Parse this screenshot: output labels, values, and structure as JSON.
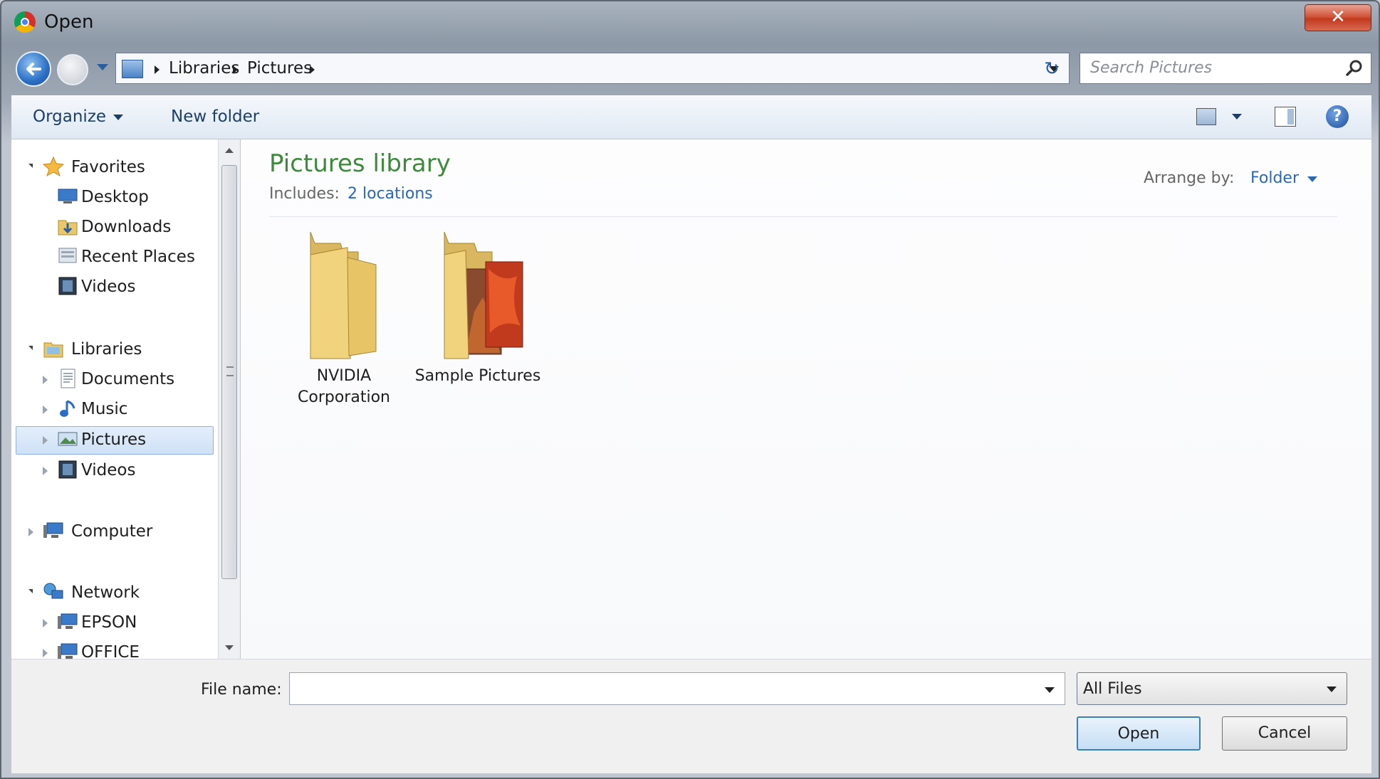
{
  "window": {
    "title": "Open",
    "close_glyph": "✕"
  },
  "address": {
    "crumbs": [
      "Libraries",
      "Pictures"
    ],
    "search_placeholder": "Search Pictures"
  },
  "toolbar": {
    "organize": "Organize",
    "new_folder": "New folder",
    "help": "?"
  },
  "nav": {
    "favorites": "Favorites",
    "fav_items": [
      "Desktop",
      "Downloads",
      "Recent Places",
      "Videos"
    ],
    "libraries": "Libraries",
    "lib_items": [
      "Documents",
      "Music",
      "Pictures",
      "Videos"
    ],
    "computer": "Computer",
    "network": "Network",
    "net_items": [
      "EPSON",
      "OFFICE"
    ],
    "selected": "Pictures"
  },
  "content": {
    "title": "Pictures library",
    "includes_label": "Includes:",
    "locations_link": "2 locations",
    "arrange_label": "Arrange by:",
    "arrange_value": "Folder",
    "folders": [
      {
        "name_line1": "NVIDIA",
        "name_line2": "Corporation"
      },
      {
        "name_line1": "Sample Pictures",
        "name_line2": ""
      }
    ]
  },
  "bottom": {
    "file_name_label": "File name:",
    "file_name_value": "",
    "file_type": "All Files",
    "open_button": "Open",
    "cancel_button": "Cancel"
  },
  "colors": {
    "library_title": "#3d8a3d",
    "link": "#2a68b5",
    "close": "#c23a1e"
  }
}
